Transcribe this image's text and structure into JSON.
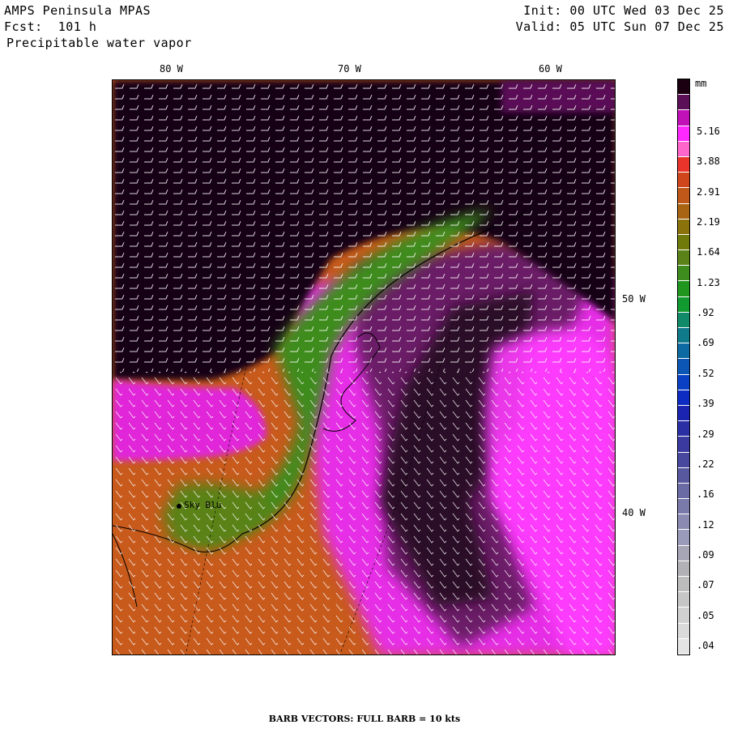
{
  "header": {
    "model": "AMPS Peninsula MPAS",
    "forecast": "Fcst:  101 h",
    "field": "Precipitable water vapor",
    "init": "Init: 00 UTC Wed 03 Dec 25",
    "valid": "Valid: 05 UTC Sun 07 Dec 25"
  },
  "axes": {
    "lon_labels": [
      "80 W",
      "70 W",
      "60 W"
    ],
    "lat_labels": [
      "50 W",
      "40 W"
    ]
  },
  "legend": {
    "unit": "mm",
    "labels": [
      "5.16",
      "3.88",
      "2.91",
      "2.19",
      "1.64",
      "1.23",
      ".92",
      ".69",
      ".52",
      ".39",
      ".29",
      ".22",
      ".16",
      ".12",
      ".09",
      ".07",
      ".05",
      ".04"
    ],
    "colors": [
      "#1a0010",
      "#5a0f56",
      "#c010b8",
      "#ff28ff",
      "#ff66cc",
      "#e8342a",
      "#d0461c",
      "#c0581a",
      "#a86412",
      "#8c720a",
      "#707a0a",
      "#5a8218",
      "#3e8c1e",
      "#20961e",
      "#109a30",
      "#108a68",
      "#0e7a8a",
      "#0e6aa2",
      "#0c56b6",
      "#0a40c4",
      "#0c2cc2",
      "#1a24b0",
      "#2a30a4",
      "#3a3aa0",
      "#48489e",
      "#58589e",
      "#6a6aa4",
      "#7a7aaa",
      "#8a8ab2",
      "#9a9aba",
      "#a6a6b6",
      "#b2b2b6",
      "#bcbcbc",
      "#c6c6c6",
      "#d0d0d0",
      "#dadada",
      "#e4e4e4"
    ]
  },
  "station": {
    "label": "Sky Blu"
  },
  "footer": "BARB VECTORS:  FULL BARB = 10 kts"
}
